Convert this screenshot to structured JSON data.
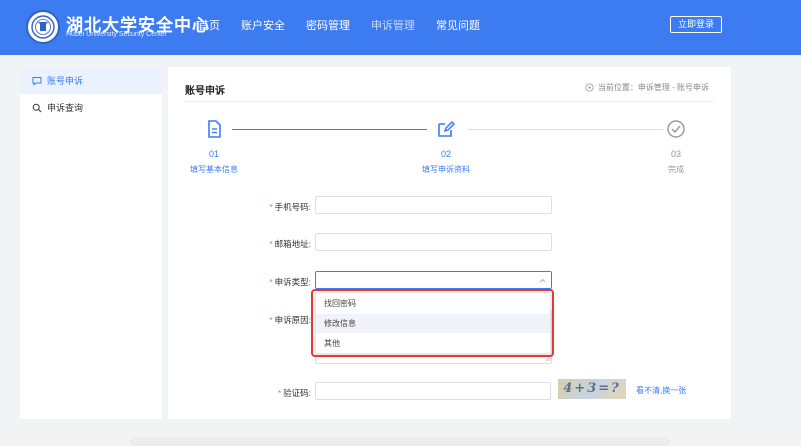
{
  "header": {
    "logo_title": "湖北大学安全中心",
    "logo_subtitle": "Hubei University Security Center",
    "nav": [
      {
        "label": "首页",
        "active": true
      },
      {
        "label": "账户安全",
        "active": true
      },
      {
        "label": "密码管理",
        "active": true
      },
      {
        "label": "申诉管理",
        "active": false
      },
      {
        "label": "常见问题",
        "active": true
      }
    ],
    "login_label": "立即登录"
  },
  "sidebar": {
    "items": [
      {
        "label": "账号申诉",
        "icon": "chat-icon",
        "active": true
      },
      {
        "label": "申诉查询",
        "icon": "search-icon",
        "active": false
      }
    ]
  },
  "main": {
    "title": "账号申诉",
    "breadcrumb": "当前位置：申诉管理 - 账号申诉",
    "steps": [
      {
        "num": "01",
        "name": "填写基本信息",
        "icon": "document-icon",
        "state": "done"
      },
      {
        "num": "02",
        "name": "填写申诉资料",
        "icon": "edit-icon",
        "state": "current"
      },
      {
        "num": "03",
        "name": "完成",
        "icon": "check-circle-icon",
        "state": "pending"
      }
    ]
  },
  "form": {
    "phone_label": "手机号码:",
    "phone_value": "",
    "email_label": "邮箱地址:",
    "email_value": "",
    "type_label": "申诉类型:",
    "type_value": "",
    "reason_label": "申诉原因:",
    "captcha_label": "验证码:",
    "captcha_value": "",
    "captcha_image_text": "4+3=?",
    "refresh_label": "看不清,换一张",
    "required_mark": "*"
  },
  "dropdown": {
    "options": [
      "找回密码",
      "修改信息",
      "其他"
    ],
    "hovered_index": 1
  },
  "colors": {
    "primary": "#3c7cf0",
    "highlight_box": "#e53935",
    "required": "#f56c6c"
  }
}
